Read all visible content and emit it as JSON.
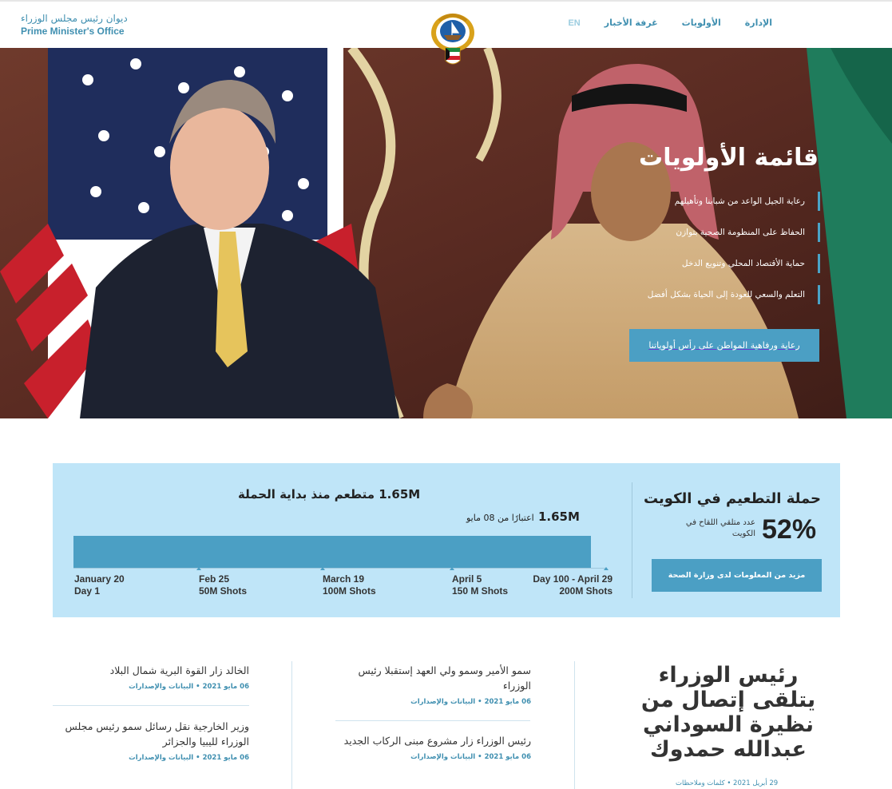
{
  "header": {
    "brand_ar": "ديوان رئيس مجلس الوزراء",
    "brand_en": "Prime Minister's Office",
    "nav": [
      "غرفة الأخبار",
      "الأولويات",
      "الإدارة"
    ],
    "lang": "EN"
  },
  "hero": {
    "title": "قائمة الأولويات",
    "priorities": [
      "رعاية الجيل الواعد من شبابنا وتأهيلهم",
      "الحفاظ على المنظومة الصحية بتوازن",
      "حماية الأقتصاد المحلي وتنويع الدخل",
      "التعلم والسعي للعودة إلى الحياة بشكل أفضل"
    ],
    "button": "رعاية ورفاهية المواطن على رأس أولوياتنا"
  },
  "vaccination": {
    "title": "حملة التطعيم في الكويت",
    "percent": "52%",
    "percent_label": "عدد متلقي اللقاح في الكويت",
    "button": "مزيد من المعلومات لدى وزارة الصحة",
    "headline": "1.65M متطعم منذ بداية الحملة",
    "as_of_value": "1.65M",
    "as_of_text": "اعتبارًا من 08 مايو",
    "progress": 0.97,
    "milestones": [
      {
        "date": "January 20",
        "label": "Day 1"
      },
      {
        "date": "Feb 25",
        "label": "50M Shots"
      },
      {
        "date": "March 19",
        "label": "100M Shots"
      },
      {
        "date": "April 5",
        "label": "150 M Shots"
      },
      {
        "date": "Day 100 - April 29",
        "label": "200M Shots"
      }
    ]
  },
  "news": {
    "main": {
      "title": "رئيس الوزراء يتلقى إتصال من نظيرة السوداني عبدالله حمدوك",
      "date": "29 أبريل 2021",
      "category": "كلمات وملاحظات"
    },
    "middle": [
      {
        "title": "سمو الأمير وسمو ولي العهد إستقبلا رئيس الوزراء",
        "date": "06 مايو 2021",
        "category": "البيانات والإصدارات"
      },
      {
        "title": "رئيس الوزراء زار مشروع مبنى الركاب الجديد",
        "date": "06 مايو 2021",
        "category": "البيانات والإصدارات"
      }
    ],
    "left": [
      {
        "title": "الخالد زار القوة البرية شمال البلاد",
        "date": "06 مايو 2021",
        "category": "البيانات والإصدارات"
      },
      {
        "title": "وزير الخارجية نقل رسائل سمو رئيس مجلس الوزراء لليبيا والجزائر",
        "date": "06 مايو 2021",
        "category": "البيانات والإصدارات"
      }
    ]
  },
  "colors": {
    "accent": "#4b9fc4",
    "panel": "#bfe5f8",
    "link": "#3f8fb0"
  }
}
